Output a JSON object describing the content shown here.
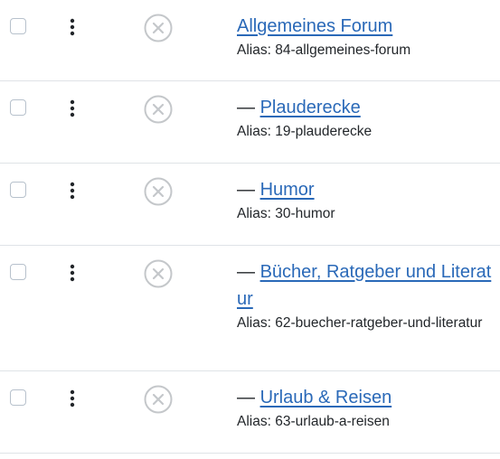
{
  "alias_prefix": "Alias: ",
  "rows": [
    {
      "title": "Allgemeines Forum",
      "alias": "84-allgemeines-forum",
      "dash": ""
    },
    {
      "title": "Plauderecke",
      "alias": "19-plauderecke",
      "dash": "— "
    },
    {
      "title": "Humor",
      "alias": "30-humor",
      "dash": "— "
    },
    {
      "title": "Bücher, Ratgeber und Literatur",
      "alias": "62-buecher-ratgeber-und-literatur",
      "dash": "— "
    },
    {
      "title": "Urlaub & Reisen",
      "alias": "63-urlaub-a-reisen",
      "dash": "— "
    }
  ],
  "icons": {
    "actions": "vertical-dots-icon",
    "status": "times-circle-icon"
  },
  "colors": {
    "link": "#2a69b8",
    "status_icon": "#c4c7ca",
    "checkbox_border": "#b7c1cc"
  }
}
